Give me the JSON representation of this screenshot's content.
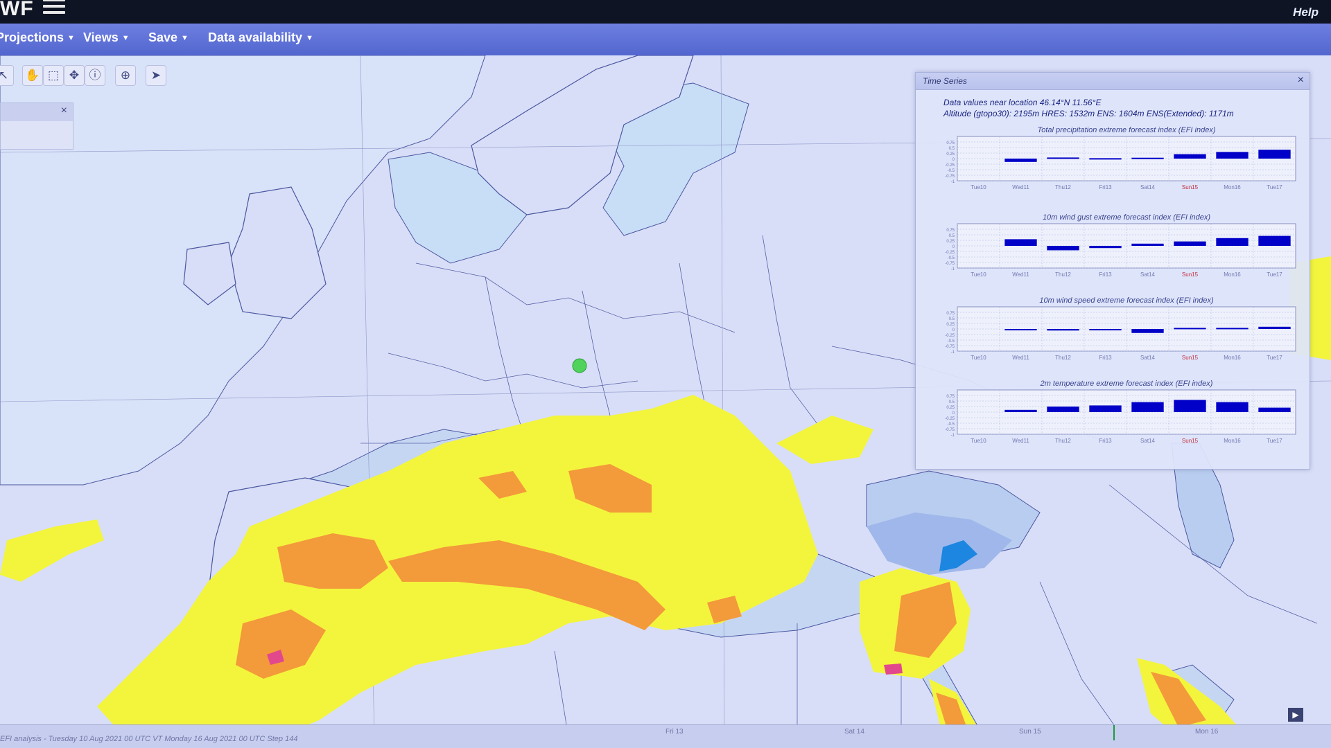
{
  "app": {
    "logo": "WF",
    "help_label": "Help"
  },
  "menu": [
    {
      "label": "Projections"
    },
    {
      "label": "Views"
    },
    {
      "label": "Save"
    },
    {
      "label": "Data availability"
    }
  ],
  "toolbar": {
    "tools": [
      {
        "name": "zoom-icon",
        "glyph": "↖"
      },
      {
        "name": "pan-hand-icon",
        "glyph": "✋"
      },
      {
        "name": "zoom-box-icon",
        "glyph": "⬚"
      },
      {
        "name": "crosshair-icon",
        "glyph": "✥"
      },
      {
        "name": "info-icon",
        "glyph": "ⓘ"
      },
      {
        "name": "location-pin-icon",
        "glyph": "⊕"
      },
      {
        "name": "path-tool-icon",
        "glyph": "➤"
      }
    ]
  },
  "layer_panel": {
    "close_glyph": "×"
  },
  "timeseries": {
    "title": "Time Series",
    "close_glyph": "×",
    "location_line": "Data values near location 46.14°N 11.56°E",
    "altitude_line": "Altitude (gtopo30): 2195m HRES: 1532m ENS: 1604m ENS(Extended): 1171m",
    "day_labels": [
      "Tue10",
      "Wed11",
      "Thu12",
      "Fri13",
      "Sat14",
      "Sun15",
      "Mon16",
      "Tue17"
    ],
    "y_ticks": [
      "0.75",
      "0.5",
      "0.25",
      "0",
      "-0.25",
      "-0.5",
      "-0.75",
      "-1"
    ]
  },
  "chart_data": [
    {
      "type": "bar",
      "title": "Total precipitation extreme forecast index (EFI index)",
      "categories": [
        "Tue10",
        "Wed11",
        "Thu12",
        "Fri13",
        "Sat14",
        "Sun15",
        "Mon16",
        "Tue17"
      ],
      "values": [
        null,
        -0.15,
        0.05,
        0.02,
        0.04,
        0.2,
        0.3,
        0.4
      ],
      "ylim": [
        -1,
        1
      ]
    },
    {
      "type": "bar",
      "title": "10m wind gust extreme forecast index (EFI index)",
      "categories": [
        "Tue10",
        "Wed11",
        "Thu12",
        "Fri13",
        "Sat14",
        "Sun15",
        "Mon16",
        "Tue17"
      ],
      "values": [
        null,
        0.3,
        -0.2,
        -0.1,
        0.1,
        0.2,
        0.35,
        0.45
      ],
      "ylim": [
        -1,
        1
      ]
    },
    {
      "type": "bar",
      "title": "10m wind speed extreme forecast index (EFI index)",
      "categories": [
        "Tue10",
        "Wed11",
        "Thu12",
        "Fri13",
        "Sat14",
        "Sun15",
        "Mon16",
        "Tue17"
      ],
      "values": [
        null,
        0.0,
        -0.07,
        -0.05,
        -0.18,
        0.05,
        0.05,
        0.1
      ],
      "ylim": [
        -1,
        1
      ]
    },
    {
      "type": "bar",
      "title": "2m temperature extreme forecast index (EFI index)",
      "categories": [
        "Tue10",
        "Wed11",
        "Thu12",
        "Fri13",
        "Sat14",
        "Sun15",
        "Mon16",
        "Tue17"
      ],
      "values": [
        null,
        0.1,
        0.25,
        0.3,
        0.45,
        0.55,
        0.45,
        0.2
      ],
      "ylim": [
        -1,
        1
      ]
    }
  ],
  "colors": {
    "land": "#d8def7",
    "sea": "#c8ddf6",
    "efi_yellow": "#f3f53c",
    "efi_orange": "#f39a3a",
    "efi_magenta": "#e2488c",
    "cold_blue": "#9fb7ea",
    "deep_blue": "#1c86e0",
    "bar_fill": "#0000c8",
    "marker": "#4fd35a"
  },
  "bottom": {
    "status": "EFI analysis - Tuesday 10 Aug 2021 00 UTC VT Monday 16 Aug 2021 00 UTC Step 144",
    "timeline_days": [
      "Fri 13",
      "Sat 14",
      "Sun 15",
      "Mon 16"
    ]
  }
}
